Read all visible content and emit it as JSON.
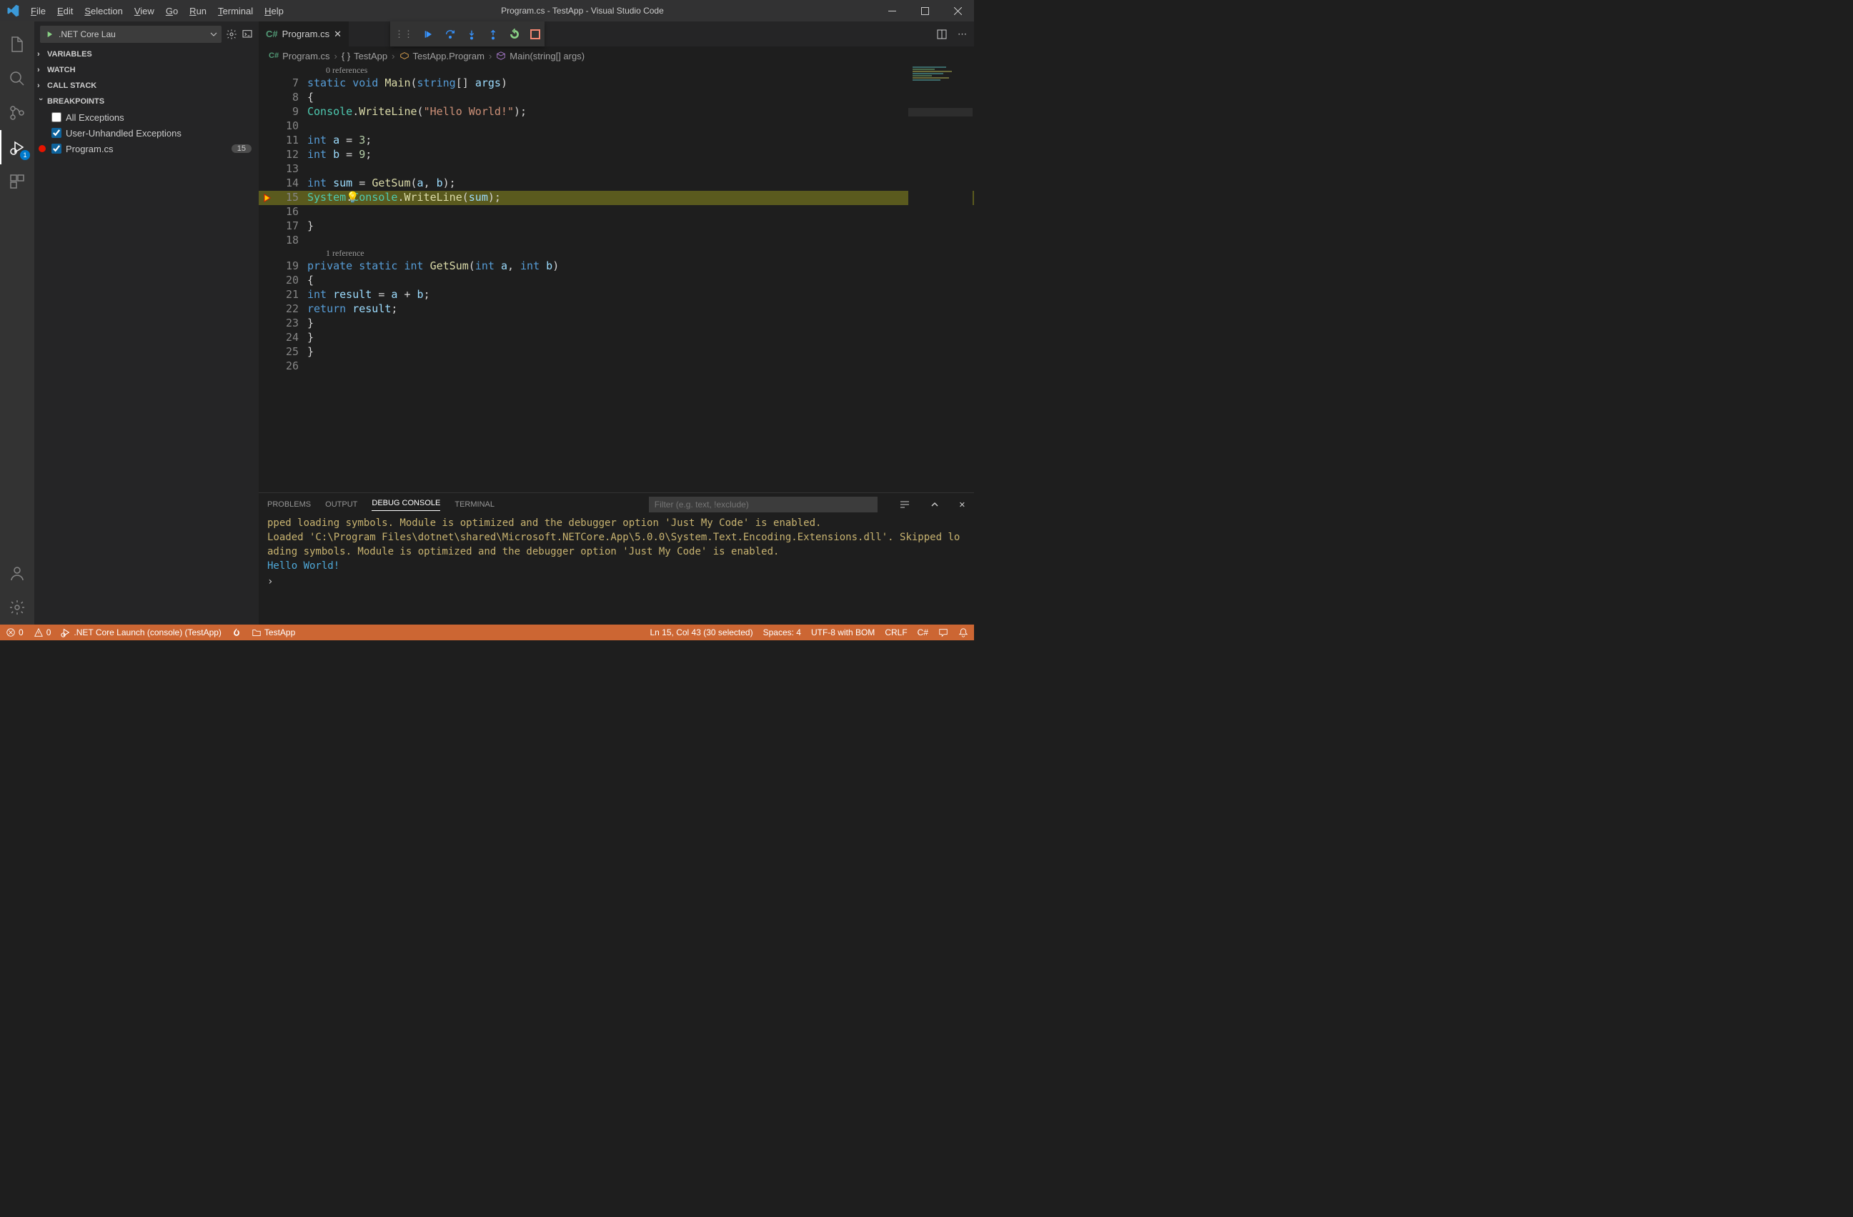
{
  "title": "Program.cs - TestApp - Visual Studio Code",
  "menu": [
    "File",
    "Edit",
    "Selection",
    "View",
    "Go",
    "Run",
    "Terminal",
    "Help"
  ],
  "activitybar": {
    "debug_badge": "1"
  },
  "sidebar": {
    "debug_config": ".NET Core Lau",
    "sections": {
      "variables": "VARIABLES",
      "watch": "WATCH",
      "callstack": "CALL STACK",
      "breakpoints": "BREAKPOINTS"
    },
    "bp_items": [
      {
        "label": "All Exceptions",
        "checked": false
      },
      {
        "label": "User-Unhandled Exceptions",
        "checked": true
      },
      {
        "label": "Program.cs",
        "checked": true,
        "linebadge": "15",
        "red": true
      }
    ]
  },
  "tab": {
    "label": "Program.cs"
  },
  "breadcrumbs": [
    {
      "icon": "csharp",
      "label": "Program.cs"
    },
    {
      "icon": "braces",
      "label": "TestApp"
    },
    {
      "icon": "class",
      "label": "TestApp.Program"
    },
    {
      "icon": "cube",
      "label": "Main(string[] args)"
    }
  ],
  "codelens": {
    "refs0": "0 references",
    "refs1": "1 reference"
  },
  "code_lines": {
    "l7_a": "static",
    "l7_b": "void",
    "l7_c": "Main",
    "l7_d": "string",
    "l7_e": "args",
    "l8": "{",
    "l9_a": "Console",
    "l9_b": "WriteLine",
    "l9_c": "\"Hello World!\"",
    "l11_a": "int",
    "l11_b": "a",
    "l11_c": "3",
    "l12_a": "int",
    "l12_b": "b",
    "l12_c": "9",
    "l14_a": "int",
    "l14_b": "sum",
    "l14_c": "GetSum",
    "l14_d": "a",
    "l14_e": "b",
    "l15_a": "System",
    "l15_b": "Console",
    "l15_c": "WriteLine",
    "l15_d": "sum",
    "l17": "}",
    "l19_a": "private",
    "l19_b": "static",
    "l19_c": "int",
    "l19_d": "GetSum",
    "l19_e": "int",
    "l19_f": "a",
    "l19_g": "int",
    "l19_h": "b",
    "l20": "{",
    "l21_a": "int",
    "l21_b": "result",
    "l21_c": "a",
    "l21_d": "b",
    "l22_a": "return",
    "l22_b": "result",
    "l23": "}",
    "l24": "}",
    "l25": "}"
  },
  "line_numbers": [
    "7",
    "8",
    "9",
    "10",
    "11",
    "12",
    "13",
    "14",
    "15",
    "16",
    "17",
    "18",
    "19",
    "20",
    "21",
    "22",
    "23",
    "24",
    "25",
    "26"
  ],
  "panel": {
    "tabs": [
      "PROBLEMS",
      "OUTPUT",
      "DEBUG CONSOLE",
      "TERMINAL"
    ],
    "filter_placeholder": "Filter (e.g. text, !exclude)",
    "log1": "pped loading symbols. Module is optimized and the debugger option 'Just My Code' is enabled.",
    "log2": "Loaded 'C:\\Program Files\\dotnet\\shared\\Microsoft.NETCore.App\\5.0.0\\System.Text.Encoding.Extensions.dll'. Skipped loading symbols. Module is optimized and the debugger option 'Just My Code' is enabled.",
    "log3": "Hello World!"
  },
  "statusbar": {
    "errors": "0",
    "warnings": "0",
    "launch": ".NET Core Launch (console) (TestApp)",
    "folder": "TestApp",
    "cursor": "Ln 15, Col 43 (30 selected)",
    "spaces": "Spaces: 4",
    "encoding": "UTF-8 with BOM",
    "eol": "CRLF",
    "lang": "C#"
  }
}
